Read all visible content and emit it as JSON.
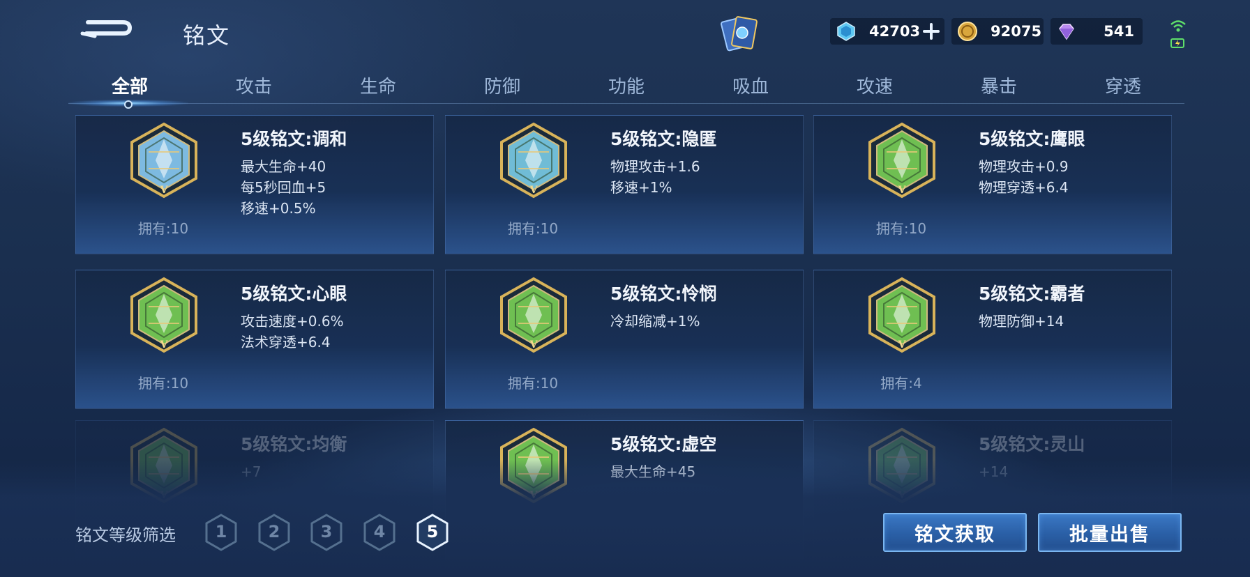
{
  "header": {
    "title": "铭文",
    "resources": {
      "diamond": "42703",
      "gold": "92075",
      "crystal": "541"
    }
  },
  "tabs": [
    "全部",
    "攻击",
    "生命",
    "防御",
    "功能",
    "吸血",
    "攻速",
    "暴击",
    "穿透"
  ],
  "active_tab_index": 0,
  "runes": [
    {
      "name": "5级铭文:调和",
      "stats": [
        "最大生命+40",
        "每5秒回血+5",
        "移速+0.5%"
      ],
      "owned": "拥有:10",
      "icon": "harmony-rune-icon",
      "color": "#8fd4ff"
    },
    {
      "name": "5级铭文:隐匿",
      "stats": [
        "物理攻击+1.6",
        "移速+1%"
      ],
      "owned": "拥有:10",
      "icon": "stealth-rune-icon",
      "color": "#7fd6f2"
    },
    {
      "name": "5级铭文:鹰眼",
      "stats": [
        "物理攻击+0.9",
        "物理穿透+6.4"
      ],
      "owned": "拥有:10",
      "icon": "hawk-eye-rune-icon",
      "color": "#7ed957"
    },
    {
      "name": "5级铭文:心眼",
      "stats": [
        "攻击速度+0.6%",
        "法术穿透+6.4"
      ],
      "owned": "拥有:10",
      "icon": "mind-eye-rune-icon",
      "color": "#7ed957"
    },
    {
      "name": "5级铭文:怜悯",
      "stats": [
        "冷却缩减+1%"
      ],
      "owned": "拥有:10",
      "icon": "mercy-rune-icon",
      "color": "#7ed957"
    },
    {
      "name": "5级铭文:霸者",
      "stats": [
        "物理防御+14"
      ],
      "owned": "拥有:4",
      "icon": "overlord-rune-icon",
      "color": "#7ed957"
    },
    {
      "name": "5级铭文:均衡",
      "stats": [
        "+7"
      ],
      "owned": "",
      "icon": "balance-rune-icon",
      "color": "#7ed957"
    },
    {
      "name": "5级铭文:虚空",
      "stats": [
        "最大生命+45"
      ],
      "owned": "",
      "icon": "void-rune-icon",
      "color": "#7ed957"
    },
    {
      "name": "5级铭文:灵山",
      "stats": [
        "+14"
      ],
      "owned": "",
      "icon": "spirit-mountain-rune-icon",
      "color": "#7ed957"
    }
  ],
  "filter": {
    "label": "铭文等级筛选",
    "levels": [
      "1",
      "2",
      "3",
      "4",
      "5"
    ],
    "active_level": "5"
  },
  "buttons": {
    "acquire": "铭文获取",
    "bulk_sell": "批量出售"
  },
  "colors": {
    "gold_frame": "#d8b35a",
    "green_gem": "#7ed957",
    "blue_gem": "#8fd4ff",
    "button_blue": "#2a5fa6"
  }
}
